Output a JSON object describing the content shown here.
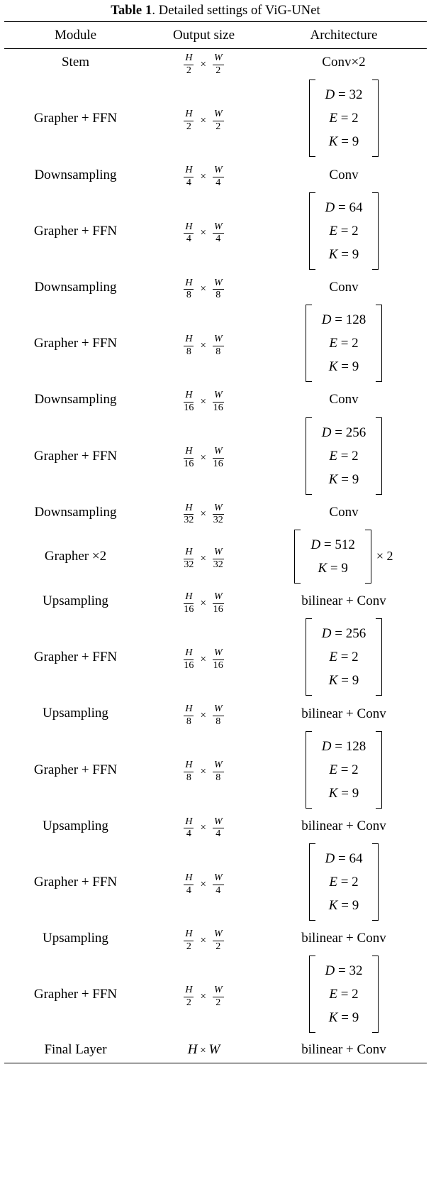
{
  "caption": {
    "label": "Table 1",
    "text": ". Detailed settings of ViG-UNet"
  },
  "columns": [
    "Module",
    "Output size",
    "Architecture"
  ],
  "chart_data": {
    "type": "table",
    "title": "Table 1. Detailed settings of ViG-UNet",
    "columns": [
      "Module",
      "Output size",
      "Architecture"
    ],
    "rows": [
      {
        "module": "Stem",
        "size": "H/2 x W/2",
        "arch": "Conv×2"
      },
      {
        "module": "Grapher + FFN",
        "size": "H/2 x W/2",
        "arch": "[D=32, E=2, K=9]"
      },
      {
        "module": "Downsampling",
        "size": "H/4 x W/4",
        "arch": "Conv"
      },
      {
        "module": "Grapher + FFN",
        "size": "H/4 x W/4",
        "arch": "[D=64, E=2, K=9]"
      },
      {
        "module": "Downsampling",
        "size": "H/8 x W/8",
        "arch": "Conv"
      },
      {
        "module": "Grapher + FFN",
        "size": "H/8 x W/8",
        "arch": "[D=128, E=2, K=9]"
      },
      {
        "module": "Downsampling",
        "size": "H/16 x W/16",
        "arch": "Conv"
      },
      {
        "module": "Grapher + FFN",
        "size": "H/16 x W/16",
        "arch": "[D=256, E=2, K=9]"
      },
      {
        "module": "Downsampling",
        "size": "H/32 x W/32",
        "arch": "Conv"
      },
      {
        "module": "Grapher ×2",
        "size": "H/32 x W/32",
        "arch": "[D=512, K=9] × 2"
      },
      {
        "module": "Upsampling",
        "size": "H/16 x W/16",
        "arch": "bilinear + Conv"
      },
      {
        "module": "Grapher + FFN",
        "size": "H/16 x W/16",
        "arch": "[D=256, E=2, K=9]"
      },
      {
        "module": "Upsampling",
        "size": "H/8 x W/8",
        "arch": "bilinear + Conv"
      },
      {
        "module": "Grapher + FFN",
        "size": "H/8 x W/8",
        "arch": "[D=128, E=2, K=9]"
      },
      {
        "module": "Upsampling",
        "size": "H/4 x W/4",
        "arch": "bilinear + Conv"
      },
      {
        "module": "Grapher + FFN",
        "size": "H/4 x W/4",
        "arch": "[D=64, E=2, K=9]"
      },
      {
        "module": "Upsampling",
        "size": "H/2 x W/2",
        "arch": "bilinear + Conv"
      },
      {
        "module": "Grapher + FFN",
        "size": "H/2 x W/2",
        "arch": "[D=32, E=2, K=9]"
      },
      {
        "module": "Final Layer",
        "size": "H x W",
        "arch": "bilinear + Conv"
      }
    ]
  },
  "rows": [
    {
      "module": "Stem",
      "size": {
        "kind": "frac",
        "num1": "H",
        "den1": "2",
        "op": "×",
        "num2": "W",
        "den2": "2"
      },
      "arch": {
        "kind": "plain",
        "text": "Conv×2"
      }
    },
    {
      "module": "Grapher + FFN",
      "size": {
        "kind": "frac",
        "num1": "H",
        "den1": "2",
        "op": "×",
        "num2": "W",
        "den2": "2"
      },
      "arch": {
        "kind": "matrix",
        "lines": [
          {
            "name": "D",
            "eq": "=",
            "val": "32"
          },
          {
            "name": "E",
            "eq": "=",
            "val": "2"
          },
          {
            "name": "K",
            "eq": "=",
            "val": "9"
          }
        ],
        "repeat": ""
      }
    },
    {
      "module": "Downsampling",
      "size": {
        "kind": "frac",
        "num1": "H",
        "den1": "4",
        "op": "×",
        "num2": "W",
        "den2": "4"
      },
      "arch": {
        "kind": "plain",
        "text": "Conv"
      }
    },
    {
      "module": "Grapher + FFN",
      "size": {
        "kind": "frac",
        "num1": "H",
        "den1": "4",
        "op": "×",
        "num2": "W",
        "den2": "4"
      },
      "arch": {
        "kind": "matrix",
        "lines": [
          {
            "name": "D",
            "eq": "=",
            "val": "64"
          },
          {
            "name": "E",
            "eq": "=",
            "val": "2"
          },
          {
            "name": "K",
            "eq": "=",
            "val": "9"
          }
        ],
        "repeat": ""
      }
    },
    {
      "module": "Downsampling",
      "size": {
        "kind": "frac",
        "num1": "H",
        "den1": "8",
        "op": "×",
        "num2": "W",
        "den2": "8"
      },
      "arch": {
        "kind": "plain",
        "text": "Conv"
      }
    },
    {
      "module": "Grapher + FFN",
      "size": {
        "kind": "frac",
        "num1": "H",
        "den1": "8",
        "op": "×",
        "num2": "W",
        "den2": "8"
      },
      "arch": {
        "kind": "matrix",
        "lines": [
          {
            "name": "D",
            "eq": "=",
            "val": "128"
          },
          {
            "name": "E",
            "eq": "=",
            "val": "2"
          },
          {
            "name": "K",
            "eq": "=",
            "val": "9"
          }
        ],
        "repeat": ""
      }
    },
    {
      "module": "Downsampling",
      "size": {
        "kind": "frac",
        "num1": "H",
        "den1": "16",
        "op": "×",
        "num2": "W",
        "den2": "16"
      },
      "arch": {
        "kind": "plain",
        "text": "Conv"
      }
    },
    {
      "module": "Grapher + FFN",
      "size": {
        "kind": "frac",
        "num1": "H",
        "den1": "16",
        "op": "×",
        "num2": "W",
        "den2": "16"
      },
      "arch": {
        "kind": "matrix",
        "lines": [
          {
            "name": "D",
            "eq": "=",
            "val": "256"
          },
          {
            "name": "E",
            "eq": "=",
            "val": "2"
          },
          {
            "name": "K",
            "eq": "=",
            "val": "9"
          }
        ],
        "repeat": ""
      }
    },
    {
      "module": "Downsampling",
      "size": {
        "kind": "frac",
        "num1": "H",
        "den1": "32",
        "op": "×",
        "num2": "W",
        "den2": "32"
      },
      "arch": {
        "kind": "plain",
        "text": "Conv"
      }
    },
    {
      "module": "Grapher ×2",
      "size": {
        "kind": "frac",
        "num1": "H",
        "den1": "32",
        "op": "×",
        "num2": "W",
        "den2": "32"
      },
      "arch": {
        "kind": "matrix",
        "lines": [
          {
            "name": "D",
            "eq": "=",
            "val": "512"
          },
          {
            "name": "K",
            "eq": "=",
            "val": "9"
          }
        ],
        "repeat": "× 2"
      }
    },
    {
      "module": "Upsampling",
      "size": {
        "kind": "frac",
        "num1": "H",
        "den1": "16",
        "op": "×",
        "num2": "W",
        "den2": "16"
      },
      "arch": {
        "kind": "plain",
        "text": "bilinear + Conv"
      }
    },
    {
      "module": "Grapher + FFN",
      "size": {
        "kind": "frac",
        "num1": "H",
        "den1": "16",
        "op": "×",
        "num2": "W",
        "den2": "16"
      },
      "arch": {
        "kind": "matrix",
        "lines": [
          {
            "name": "D",
            "eq": "=",
            "val": "256"
          },
          {
            "name": "E",
            "eq": "=",
            "val": "2"
          },
          {
            "name": "K",
            "eq": "=",
            "val": "9"
          }
        ],
        "repeat": ""
      }
    },
    {
      "module": "Upsampling",
      "size": {
        "kind": "frac",
        "num1": "H",
        "den1": "8",
        "op": "×",
        "num2": "W",
        "den2": "8"
      },
      "arch": {
        "kind": "plain",
        "text": "bilinear + Conv"
      }
    },
    {
      "module": "Grapher + FFN",
      "size": {
        "kind": "frac",
        "num1": "H",
        "den1": "8",
        "op": "×",
        "num2": "W",
        "den2": "8"
      },
      "arch": {
        "kind": "matrix",
        "lines": [
          {
            "name": "D",
            "eq": "=",
            "val": "128"
          },
          {
            "name": "E",
            "eq": "=",
            "val": "2"
          },
          {
            "name": "K",
            "eq": "=",
            "val": "9"
          }
        ],
        "repeat": ""
      }
    },
    {
      "module": "Upsampling",
      "size": {
        "kind": "frac",
        "num1": "H",
        "den1": "4",
        "op": "×",
        "num2": "W",
        "den2": "4"
      },
      "arch": {
        "kind": "plain",
        "text": "bilinear + Conv"
      }
    },
    {
      "module": "Grapher + FFN",
      "size": {
        "kind": "frac",
        "num1": "H",
        "den1": "4",
        "op": "×",
        "num2": "W",
        "den2": "4"
      },
      "arch": {
        "kind": "matrix",
        "lines": [
          {
            "name": "D",
            "eq": "=",
            "val": "64"
          },
          {
            "name": "E",
            "eq": "=",
            "val": "2"
          },
          {
            "name": "K",
            "eq": "=",
            "val": "9"
          }
        ],
        "repeat": ""
      }
    },
    {
      "module": "Upsampling",
      "size": {
        "kind": "frac",
        "num1": "H",
        "den1": "2",
        "op": "×",
        "num2": "W",
        "den2": "2"
      },
      "arch": {
        "kind": "plain",
        "text": "bilinear + Conv"
      }
    },
    {
      "module": "Grapher + FFN",
      "size": {
        "kind": "frac",
        "num1": "H",
        "den1": "2",
        "op": "×",
        "num2": "W",
        "den2": "2"
      },
      "arch": {
        "kind": "matrix",
        "lines": [
          {
            "name": "D",
            "eq": "=",
            "val": "32"
          },
          {
            "name": "E",
            "eq": "=",
            "val": "2"
          },
          {
            "name": "K",
            "eq": "=",
            "val": "9"
          }
        ],
        "repeat": ""
      }
    },
    {
      "module": "Final Layer",
      "size": {
        "kind": "plain",
        "num1": "H",
        "op": "×",
        "num2": "W"
      },
      "arch": {
        "kind": "plain",
        "text": "bilinear + Conv"
      }
    }
  ]
}
